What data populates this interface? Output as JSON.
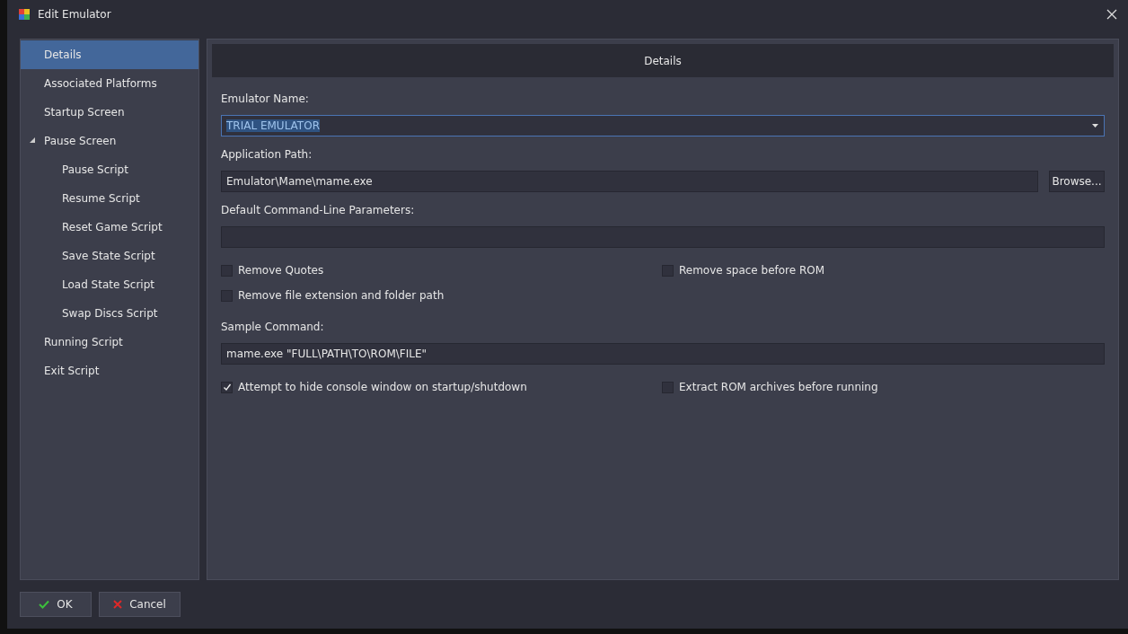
{
  "window": {
    "title": "Edit Emulator"
  },
  "sidebar": {
    "items": [
      {
        "label": "Details",
        "selected": true
      },
      {
        "label": "Associated Platforms",
        "selected": false
      },
      {
        "label": "Startup Screen",
        "selected": false
      },
      {
        "label": "Pause Screen",
        "selected": false,
        "expanded": true,
        "children": [
          {
            "label": "Pause Script",
            "selected": false
          },
          {
            "label": "Resume Script",
            "selected": false
          },
          {
            "label": "Reset Game Script",
            "selected": false
          },
          {
            "label": "Save State Script",
            "selected": false
          },
          {
            "label": "Load State Script",
            "selected": false
          },
          {
            "label": "Swap Discs Script",
            "selected": false
          }
        ]
      },
      {
        "label": "Running Script",
        "selected": false
      },
      {
        "label": "Exit Script",
        "selected": false
      }
    ]
  },
  "panel": {
    "header": "Details",
    "emulator_name": {
      "label": "Emulator Name:",
      "value": "TRIAL EMULATOR"
    },
    "application_path": {
      "label": "Application Path:",
      "value": "Emulator\\Mame\\mame.exe",
      "button": "Browse..."
    },
    "parameters": {
      "label": "Default Command-Line Parameters:"
    },
    "options": [
      {
        "label": "Remove Quotes",
        "checked": false
      },
      {
        "label": "Remove space before ROM",
        "checked": false
      },
      {
        "label": "Remove file extension and folder path",
        "checked": false
      }
    ],
    "sample_command": {
      "label": "Sample Command:",
      "value": "mame.exe \"FULL\\PATH\\TO\\ROM\\FILE\""
    },
    "options_2": [
      {
        "label": "Attempt to hide console window on startup/shutdown",
        "checked": true
      },
      {
        "label": "Extract ROM archives before running",
        "checked": false
      }
    ]
  },
  "buttons": [
    {
      "label": "OK",
      "kind": "ok"
    },
    {
      "label": "Cancel",
      "kind": "cancel"
    }
  ]
}
